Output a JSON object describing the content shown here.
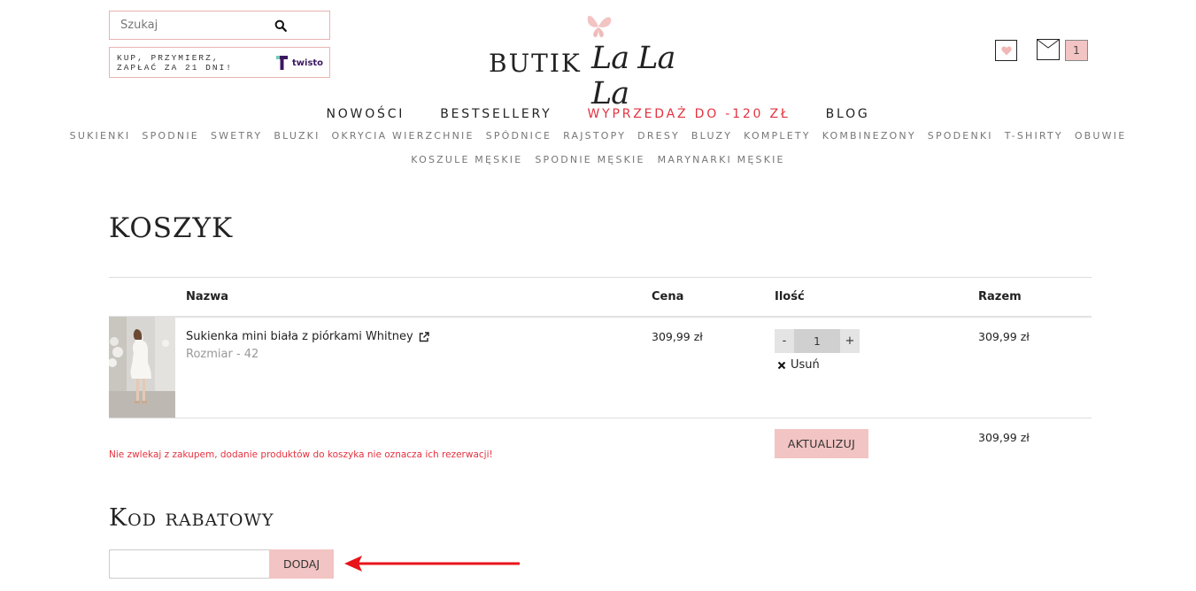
{
  "header": {
    "search_placeholder": "Szukaj",
    "twisto_text": "KUP, PRZYMIERZ, ZAPŁAĆ ZA 21 DNI!",
    "twisto_brand": "twisto",
    "logo_main": "BUTIK",
    "logo_script": "La La La",
    "cart_count": "1"
  },
  "main_nav": [
    {
      "label": "NOWOŚCI"
    },
    {
      "label": "BESTSELLERY"
    },
    {
      "label": "WYPRZEDAŻ DO -120 ZŁ"
    },
    {
      "label": "BLOG"
    }
  ],
  "categories_row1": [
    "SUKIENKI",
    "SPODNIE",
    "SWETRY",
    "BLUZKI",
    "OKRYCIA WIERZCHNIE",
    "SPÓDNICE",
    "RAJSTOPY",
    "DRESY",
    "BLUZY",
    "KOMPLETY",
    "KOMBINEZONY",
    "SPODENKI",
    "T-SHIRTY",
    "OBUWIE"
  ],
  "categories_row2": [
    "KOSZULE MĘSKIE",
    "SPODNIE MĘSKIE",
    "MARYNARKI MĘSKIE"
  ],
  "page_title": "KOSZYK",
  "table": {
    "headers": {
      "name": "Nazwa",
      "price": "Cena",
      "qty": "Ilość",
      "total": "Razem"
    },
    "items": [
      {
        "name": "Sukienka mini biała z piórkami Whitney",
        "size": "Rozmiar - 42",
        "price": "309,99 zł",
        "qty": "1",
        "total": "309,99 zł"
      }
    ],
    "qty_minus": "-",
    "qty_plus": "+",
    "remove_label": "Usuń",
    "grand_total": "309,99 zł",
    "update_label": "AKTUALIZUJ",
    "warning": "Nie zwlekaj z zakupem, dodanie produktów do koszyka nie oznacza ich rezerwacji!"
  },
  "coupon": {
    "title": "Kod rabatowy",
    "button_label": "DODAJ",
    "input_value": ""
  },
  "colors": {
    "accent_pink": "#f2c4c3",
    "sale_red": "#e3323f",
    "arrow_red": "#e8141b"
  }
}
